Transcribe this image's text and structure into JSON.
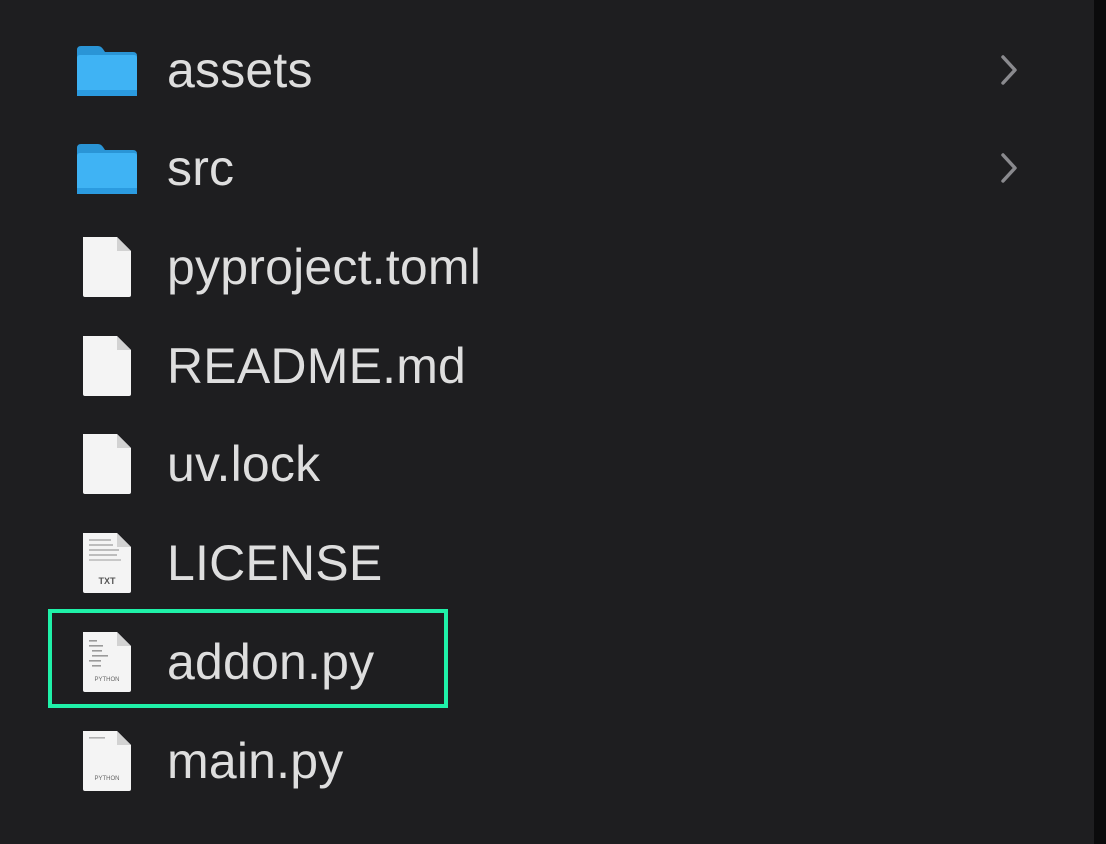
{
  "file_list": {
    "items": [
      {
        "name": "assets",
        "kind": "folder",
        "icon": "folder-icon",
        "has_children": true
      },
      {
        "name": "src",
        "kind": "folder",
        "icon": "folder-icon",
        "has_children": true
      },
      {
        "name": "pyproject.toml",
        "kind": "file",
        "icon": "document-icon",
        "has_children": false
      },
      {
        "name": "README.md",
        "kind": "file",
        "icon": "document-icon",
        "has_children": false
      },
      {
        "name": "uv.lock",
        "kind": "file",
        "icon": "document-icon",
        "has_children": false
      },
      {
        "name": "LICENSE",
        "kind": "file",
        "icon": "text-file-icon",
        "badge": "TXT",
        "has_children": false
      },
      {
        "name": "addon.py",
        "kind": "file",
        "icon": "python-file-icon",
        "badge": "PYTHON",
        "has_children": false,
        "highlighted": true
      },
      {
        "name": "main.py",
        "kind": "file",
        "icon": "python-file-icon",
        "badge": "PYTHON",
        "has_children": false
      }
    ]
  },
  "colors": {
    "background": "#1e1e20",
    "text": "#dedede",
    "folder": "#34aef2",
    "highlight": "#1ff1a8",
    "chevron": "#8a8a8e"
  }
}
